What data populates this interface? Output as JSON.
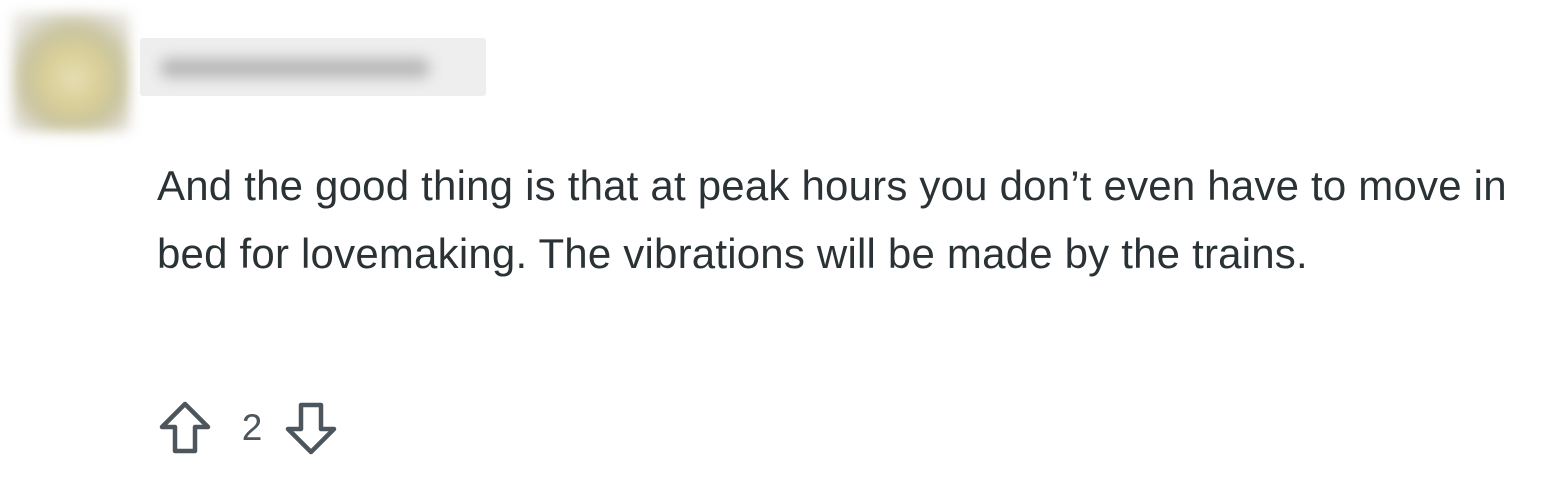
{
  "comment": {
    "body": "And the good thing is that at peak hours you don’t even have to move in bed for lovemaking. The vibrations will be made by the trains.",
    "score": "2"
  },
  "icons": {
    "upvote": "arrow-up-outline-icon",
    "downvote": "arrow-down-outline-icon"
  },
  "colors": {
    "text": "#2a3236",
    "icon": "#4c565c"
  }
}
